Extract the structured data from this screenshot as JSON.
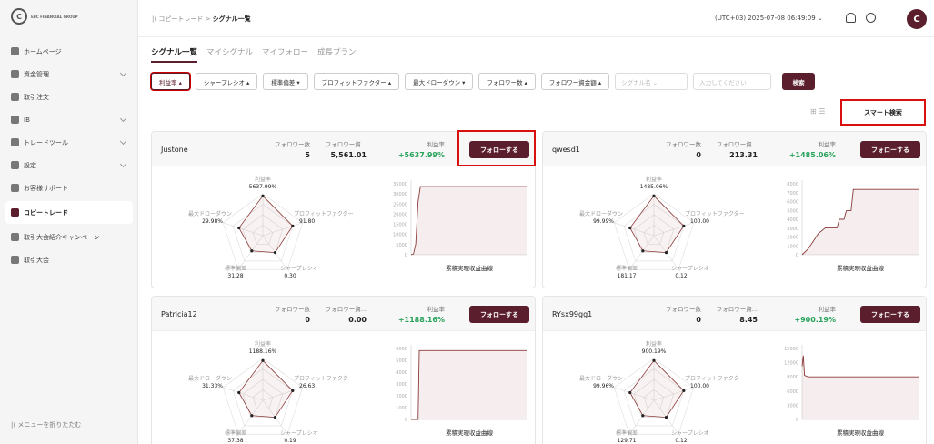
{
  "sidebar": {
    "logo_text": "EBC FINANCIAL GROUP",
    "items": [
      {
        "label": "ホームページ",
        "icon": "home-icon",
        "chevron": false,
        "active": false
      },
      {
        "label": "資金管理",
        "icon": "wallet-icon",
        "chevron": true,
        "active": false
      },
      {
        "label": "取引注文",
        "icon": "order-icon",
        "chevron": false,
        "active": false
      },
      {
        "label": "IB",
        "icon": "ib-icon",
        "chevron": true,
        "active": false
      },
      {
        "label": "トレードツール",
        "icon": "tool-icon",
        "chevron": true,
        "active": false
      },
      {
        "label": "設定",
        "icon": "settings-icon",
        "chevron": true,
        "active": false
      },
      {
        "label": "お客様サポート",
        "icon": "support-icon",
        "chevron": false,
        "active": false
      },
      {
        "label": "コピートレード",
        "icon": "copy-icon",
        "chevron": false,
        "active": true
      },
      {
        "label": "取引大会紹介キャンペーン",
        "icon": "campaign-icon",
        "chevron": false,
        "active": false
      },
      {
        "label": "取引大会",
        "icon": "trophy-icon",
        "chevron": false,
        "active": false
      }
    ],
    "collapse_label": "|⟨ メニューを折りたたむ"
  },
  "topbar": {
    "crumb_prefix": "|⟨  コピートレード  >",
    "crumb_current": "シグナル一覧",
    "timezone": "(UTC+03) 2025-07-08 06:49:09  ⌄",
    "avatar_letter": "C"
  },
  "tabs": [
    "シグナル一覧",
    "マイシグナル",
    "マイフォロー",
    "成長プラン"
  ],
  "filters": {
    "buttons": [
      "利益率 ▴",
      "シャープレシオ ▴",
      "標準偏差 ▾",
      "プロフィットファクター ▴",
      "最大ドローダウン ▾",
      "フォロワー数 ▴",
      "フォロワー資金額 ▴"
    ],
    "select_placeholder": "シグナル名    ⌄",
    "input_placeholder": "入力してください",
    "search_label": "検索",
    "view_icons": "⊞  ☰",
    "smart_search": "スマート検索"
  },
  "labels": {
    "followers": "フォロワー数",
    "follower_funds": "フォロワー資...",
    "profit_rate": "利益率",
    "follow": "フォローする",
    "radar_profit": "利益率",
    "radar_pf": "プロフィットファクター",
    "radar_sharpe": "シャープレシオ",
    "radar_std": "標準偏差",
    "radar_dd": "最大ドローダウン",
    "curve_title": "累積実現収益曲線"
  },
  "cards": [
    {
      "name": "Justone",
      "followers": "5",
      "funds": "5,561.01",
      "profit": "+5637.99%",
      "radar": {
        "profit": "5637.99%",
        "pf": "91.80",
        "sharpe": "0.30",
        "std": "31.28",
        "dd": "29.98%"
      },
      "yticks": [
        "35000",
        "30000",
        "25000",
        "20000",
        "15000",
        "10000",
        "5000",
        "0"
      ],
      "curve": [
        [
          0,
          0
        ],
        [
          0.02,
          0.01
        ],
        [
          0.04,
          0.15
        ],
        [
          0.05,
          0.45
        ],
        [
          0.06,
          0.75
        ],
        [
          0.08,
          0.96
        ],
        [
          1,
          0.96
        ]
      ],
      "highlight": true
    },
    {
      "name": "qwesd1",
      "followers": "0",
      "funds": "213.31",
      "profit": "+1485.06%",
      "radar": {
        "profit": "1485.06%",
        "pf": "100.00",
        "sharpe": "0.12",
        "std": "181.17",
        "dd": "99.99%"
      },
      "yticks": [
        "8000",
        "7000",
        "6000",
        "5000",
        "4000",
        "3000",
        "2000",
        "1000",
        "0"
      ],
      "curve": [
        [
          0,
          0
        ],
        [
          0.05,
          0.08
        ],
        [
          0.1,
          0.2
        ],
        [
          0.14,
          0.3
        ],
        [
          0.2,
          0.38
        ],
        [
          0.3,
          0.38
        ],
        [
          0.32,
          0.5
        ],
        [
          0.36,
          0.5
        ],
        [
          0.38,
          0.62
        ],
        [
          0.42,
          0.62
        ],
        [
          0.44,
          0.92
        ],
        [
          1,
          0.92
        ]
      ],
      "highlight": false
    },
    {
      "name": "Patricia12",
      "followers": "0",
      "funds": "0.00",
      "profit": "+1188.16%",
      "radar": {
        "profit": "1188.16%",
        "pf": "26.63",
        "sharpe": "0.19",
        "std": "37.38",
        "dd": "31.33%"
      },
      "yticks": [
        "6000",
        "5000",
        "4000",
        "3000",
        "2000",
        "1000",
        "0"
      ],
      "curve": [
        [
          0,
          0
        ],
        [
          0.06,
          0.0
        ],
        [
          0.07,
          0.97
        ],
        [
          1,
          0.97
        ]
      ],
      "highlight": false
    },
    {
      "name": "RYsx99gg1",
      "followers": "0",
      "funds": "8.45",
      "profit": "+900.19%",
      "radar": {
        "profit": "900.19%",
        "pf": "100.00",
        "sharpe": "0.12",
        "std": "129.71",
        "dd": "99.96%"
      },
      "yticks": [
        "15000",
        "12000",
        "9000",
        "6000",
        "3000",
        "0"
      ],
      "curve": [
        [
          0,
          0.75
        ],
        [
          0.01,
          0.9
        ],
        [
          0.02,
          0.62
        ],
        [
          0.05,
          0.6
        ],
        [
          1,
          0.6
        ]
      ],
      "highlight": false
    }
  ],
  "colors": {
    "brand": "#5a1e2d",
    "positive": "#27a35a",
    "highlight": "#d81010"
  }
}
